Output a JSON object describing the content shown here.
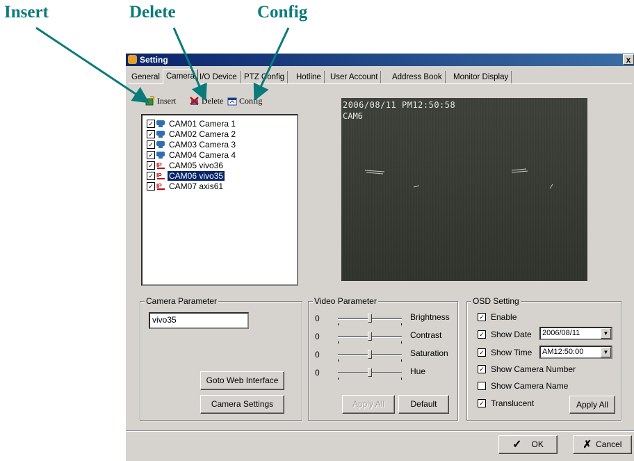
{
  "callouts": {
    "insert": "Insert",
    "delete": "Delete",
    "config": "Config"
  },
  "window": {
    "title": "Setting",
    "close": "x"
  },
  "tabs": [
    {
      "label": "General"
    },
    {
      "label": "Camera"
    },
    {
      "label": "I/O Device"
    },
    {
      "label": "PTZ Config"
    },
    {
      "label": "Hotline"
    },
    {
      "label": "User Account"
    },
    {
      "label": "Address Book"
    },
    {
      "label": "Monitor Display"
    }
  ],
  "toolbar": {
    "insert": "Insert",
    "delete": "Delete",
    "config": "Config"
  },
  "cameras": [
    {
      "id": "CAM01",
      "label": "CAM01 Camera 1",
      "type": "analog",
      "checked": true
    },
    {
      "id": "CAM02",
      "label": "CAM02 Camera 2",
      "type": "analog",
      "checked": true
    },
    {
      "id": "CAM03",
      "label": "CAM03 Camera 3",
      "type": "analog",
      "checked": true
    },
    {
      "id": "CAM04",
      "label": "CAM04 Camera 4",
      "type": "analog",
      "checked": true
    },
    {
      "id": "CAM05",
      "label": "CAM05 vivo36",
      "type": "ip",
      "checked": true
    },
    {
      "id": "CAM06",
      "label": "CAM06 vivo35",
      "type": "ip",
      "checked": true,
      "selected": true
    },
    {
      "id": "CAM07",
      "label": "CAM07 axis61",
      "type": "ip",
      "checked": true
    }
  ],
  "video": {
    "timestamp": "2006/08/11 PM12:50:58",
    "camera": "CAM6"
  },
  "camera_parameter": {
    "legend": "Camera Parameter",
    "name_value": "vivo35",
    "goto_web": "Goto Web Interface",
    "camera_settings": "Camera Settings"
  },
  "video_parameter": {
    "legend": "Video Parameter",
    "sliders": [
      {
        "value": "0",
        "label": "Brightness"
      },
      {
        "value": "0",
        "label": "Contrast"
      },
      {
        "value": "0",
        "label": "Saturation"
      },
      {
        "value": "0",
        "label": "Hue"
      }
    ],
    "apply_all": "Apply All",
    "default": "Default"
  },
  "osd": {
    "legend": "OSD Setting",
    "enable": {
      "label": "Enable",
      "checked": true
    },
    "show_date": {
      "label": "Show Date",
      "checked": true,
      "value": "2006/08/11"
    },
    "show_time": {
      "label": "Show Time",
      "checked": true,
      "value": "AM12:50:00"
    },
    "show_camera_number": {
      "label": "Show Camera Number",
      "checked": true
    },
    "show_camera_name": {
      "label": "Show Camera Name",
      "checked": false
    },
    "translucent": {
      "label": "Translucent",
      "checked": true
    },
    "apply_all": "Apply All"
  },
  "footer": {
    "ok": "OK",
    "cancel": "Cancel"
  },
  "colors": {
    "callout": "#0a7a7a",
    "selection": "#0a246a",
    "title_bar": "#0a246a",
    "window_bg": "#d6d3ce"
  }
}
